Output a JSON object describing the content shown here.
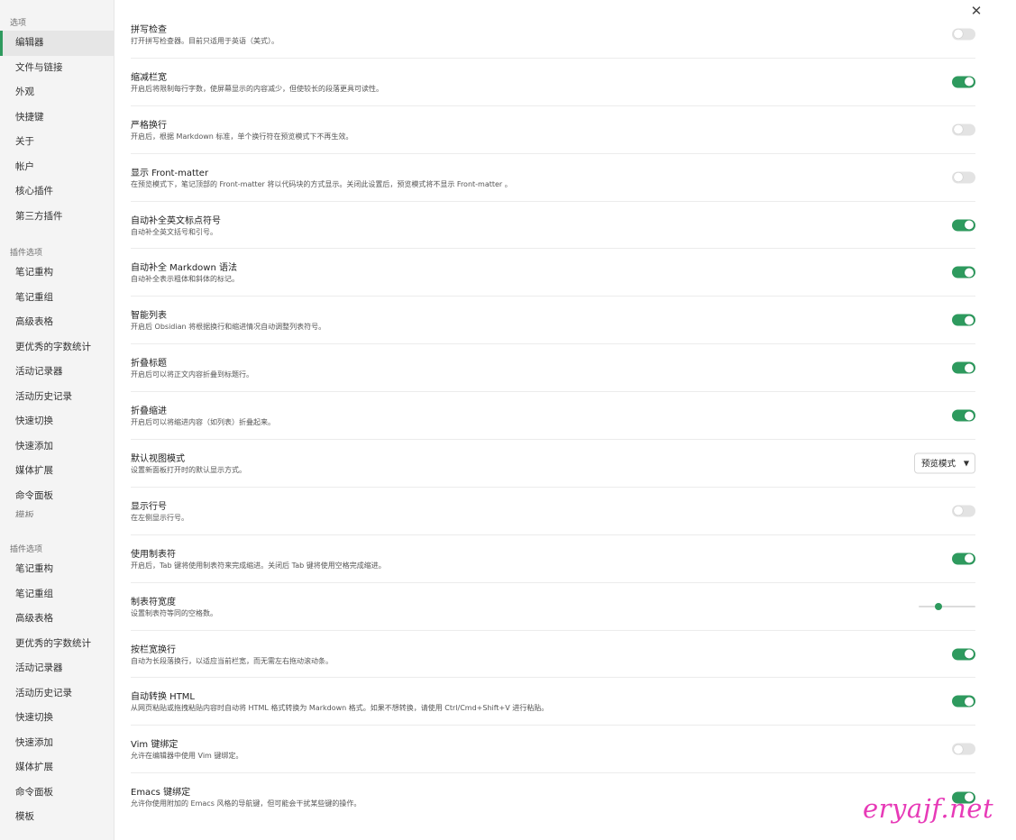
{
  "sidebar": {
    "group1_heading": "选项",
    "group1": [
      "编辑器",
      "文件与链接",
      "外观",
      "快捷键",
      "关于",
      "帐户",
      "核心插件",
      "第三方插件"
    ],
    "group2_heading": "插件选项",
    "group2": [
      "笔记重构",
      "笔记重组",
      "高级表格",
      "更优秀的字数统计",
      "活动记录器",
      "活动历史记录",
      "快速切换",
      "快速添加",
      "媒体扩展",
      "命令面板",
      "模板"
    ],
    "group3_heading": "插件选项",
    "group3": [
      "笔记重构",
      "笔记重组",
      "高级表格",
      "更优秀的字数统计",
      "活动记录器",
      "活动历史记录",
      "快速切换",
      "快速添加",
      "媒体扩展",
      "命令面板",
      "模板"
    ]
  },
  "close_label": "✕",
  "settings": [
    {
      "name": "拼写检查",
      "desc": "打开拼写检查器。目前只适用于英语（美式）。",
      "type": "toggle",
      "on": false
    },
    {
      "name": "缩减栏宽",
      "desc": "开启后将限制每行字数，使屏幕显示的内容减少，但使较长的段落更具可读性。",
      "type": "toggle",
      "on": true
    },
    {
      "name": "严格换行",
      "desc": "开启后，根据 Markdown 标准，单个换行符在预览模式下不再生效。",
      "type": "toggle",
      "on": false
    },
    {
      "name": "显示 Front-matter",
      "desc": "在预览模式下，笔记顶部的 Front-matter 将以代码块的方式显示。关闭此设置后，预览模式将不显示 Front-matter 。",
      "type": "toggle",
      "on": false
    },
    {
      "name": "自动补全英文标点符号",
      "desc": "自动补全英文括号和引号。",
      "type": "toggle",
      "on": true
    },
    {
      "name": "自动补全 Markdown 语法",
      "desc": "自动补全表示粗体和斜体的标记。",
      "type": "toggle",
      "on": true
    },
    {
      "name": "智能列表",
      "desc": "开启后 Obsidian 将根据换行和缩进情况自动调整列表符号。",
      "type": "toggle",
      "on": true
    },
    {
      "name": "折叠标题",
      "desc": "开启后可以将正文内容折叠到标题行。",
      "type": "toggle",
      "on": true
    },
    {
      "name": "折叠缩进",
      "desc": "开启后可以将缩进内容（如列表）折叠起来。",
      "type": "toggle",
      "on": true
    },
    {
      "name": "默认视图模式",
      "desc": "设置新面板打开时的默认显示方式。",
      "type": "dropdown",
      "value": "预览模式"
    },
    {
      "name": "显示行号",
      "desc": "在左侧显示行号。",
      "type": "toggle",
      "on": false
    },
    {
      "name": "使用制表符",
      "desc": "开启后，Tab 键将使用制表符来完成缩进。关闭后 Tab 键将使用空格完成缩进。",
      "type": "toggle",
      "on": true
    },
    {
      "name": "制表符宽度",
      "desc": "设置制表符等同的空格数。",
      "type": "slider",
      "value": 0.35
    },
    {
      "name": "按栏宽换行",
      "desc": "自动为长段落换行，以适应当前栏宽，而无需左右拖动滚动条。",
      "type": "toggle",
      "on": true
    },
    {
      "name": "自动转换 HTML",
      "desc": "从网页粘贴或拖拽粘贴内容时自动将 HTML 格式转换为 Markdown 格式。如果不想转换，请使用 Ctrl/Cmd+Shift+V 进行粘贴。",
      "type": "toggle",
      "on": true
    },
    {
      "name": "Vim 键绑定",
      "desc": "允许在编辑器中使用 Vim 键绑定。",
      "type": "toggle",
      "on": false
    },
    {
      "name": "Emacs 键绑定",
      "desc": "允许你使用附加的 Emacs 风格的导航键，但可能会干扰某些键的操作。",
      "type": "toggle",
      "on": true
    }
  ],
  "accent_color": "#2e9a5e",
  "watermark": "eryajf.net"
}
